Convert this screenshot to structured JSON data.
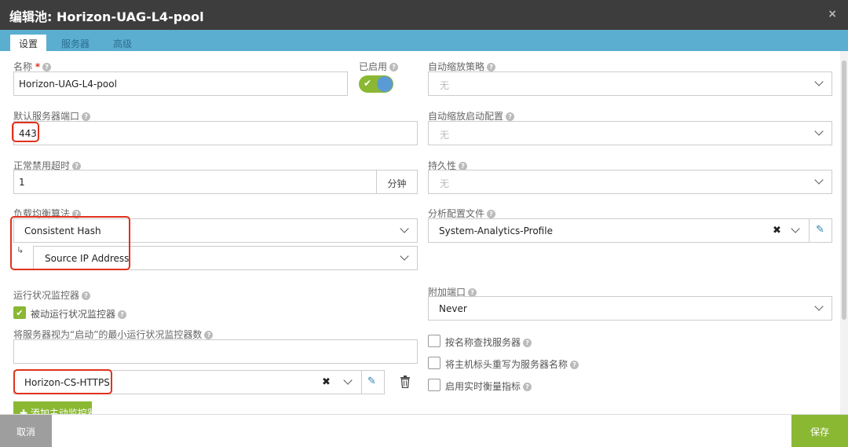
{
  "dialog": {
    "title_prefix": "编辑池",
    "title_name": "Horizon-UAG-L4-pool",
    "close_glyph": "×"
  },
  "tabs": [
    {
      "label": "设置",
      "active": true
    },
    {
      "label": "服务器",
      "active": false
    },
    {
      "label": "高级",
      "active": false
    }
  ],
  "left": {
    "name": {
      "label": "名称",
      "required_mark": "*",
      "value": "Horizon-UAG-L4-pool"
    },
    "enabled": {
      "label": "已启用",
      "value": true
    },
    "default_port": {
      "label": "默认服务器端口",
      "value": "443"
    },
    "graceful_timeout": {
      "label": "正常禁用超时",
      "value": "1",
      "unit": "分钟"
    },
    "lb_algorithm": {
      "label": "负载均衡算法",
      "value": "Consistent Hash",
      "sub_value": "Source IP Address"
    },
    "health_monitor": {
      "label": "运行状况监控器",
      "passive_label": "被动运行状况监控器",
      "passive_checked": true,
      "min_up_label": "将服务器视为“启动”的最小运行状况监控器数",
      "min_up_value": "",
      "monitor_value": "Horizon-CS-HTTPS",
      "add_button": "添加主动监控器"
    }
  },
  "right": {
    "autoscale_policy": {
      "label": "自动缩放策略",
      "value": "无"
    },
    "autoscale_launch": {
      "label": "自动缩放启动配置",
      "value": "无"
    },
    "persistence": {
      "label": "持久性",
      "value": "无"
    },
    "analytics_profile": {
      "label": "分析配置文件",
      "value": "System-Analytics-Profile"
    },
    "append_port": {
      "label": "附加端口",
      "value": "Never"
    },
    "checkboxes": [
      {
        "label": "按名称查找服务器",
        "checked": false
      },
      {
        "label": "将主机标头重写为服务器名称",
        "checked": false
      },
      {
        "label": "启用实时衡量指标",
        "checked": false
      }
    ]
  },
  "footer": {
    "cancel": "取消",
    "save": "保存"
  },
  "colors": {
    "accent_green": "#8ab833",
    "tab_blue": "#5baed0",
    "highlight_red": "#e0321c",
    "title_bg": "#3d3d3d"
  }
}
